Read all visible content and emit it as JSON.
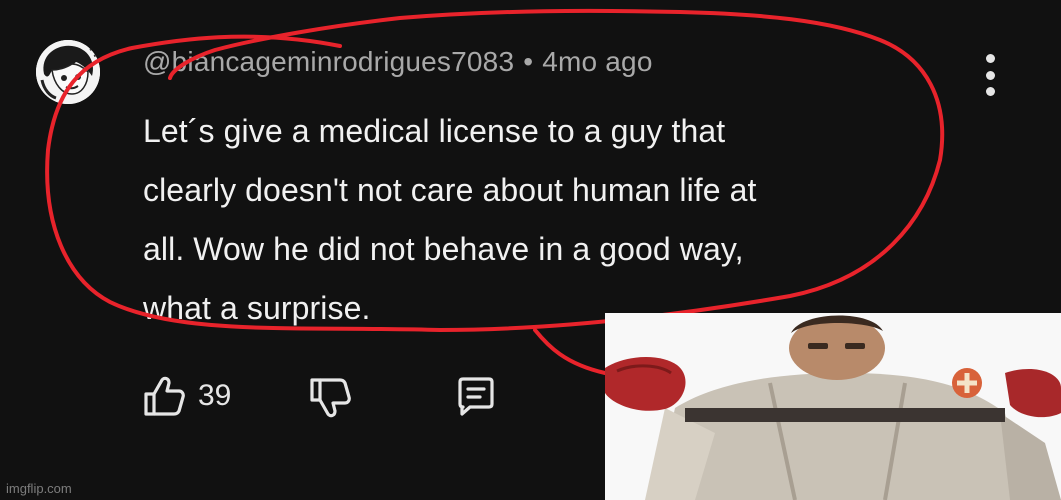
{
  "comment": {
    "handle": "@biancageminrodrigues7083",
    "separator": "•",
    "time_ago": "4mo ago",
    "lines": [
      "Let´s give a medical license to a guy that",
      "clearly doesn't not care about human life at",
      "all. Wow he did not behave in a good way,",
      "what a surprise."
    ],
    "like_count": "39"
  },
  "icons": {
    "avatar": "avatar-drawing",
    "more": "kebab-menu-icon",
    "like": "thumbs-up-icon",
    "dislike": "thumbs-down-icon",
    "reply": "comment-icon"
  },
  "colors": {
    "background": "#111111",
    "text": "#f1f1f1",
    "meta": "#a9a9a9",
    "annotation": "#e8232b"
  },
  "watermark": "imgflip.com"
}
